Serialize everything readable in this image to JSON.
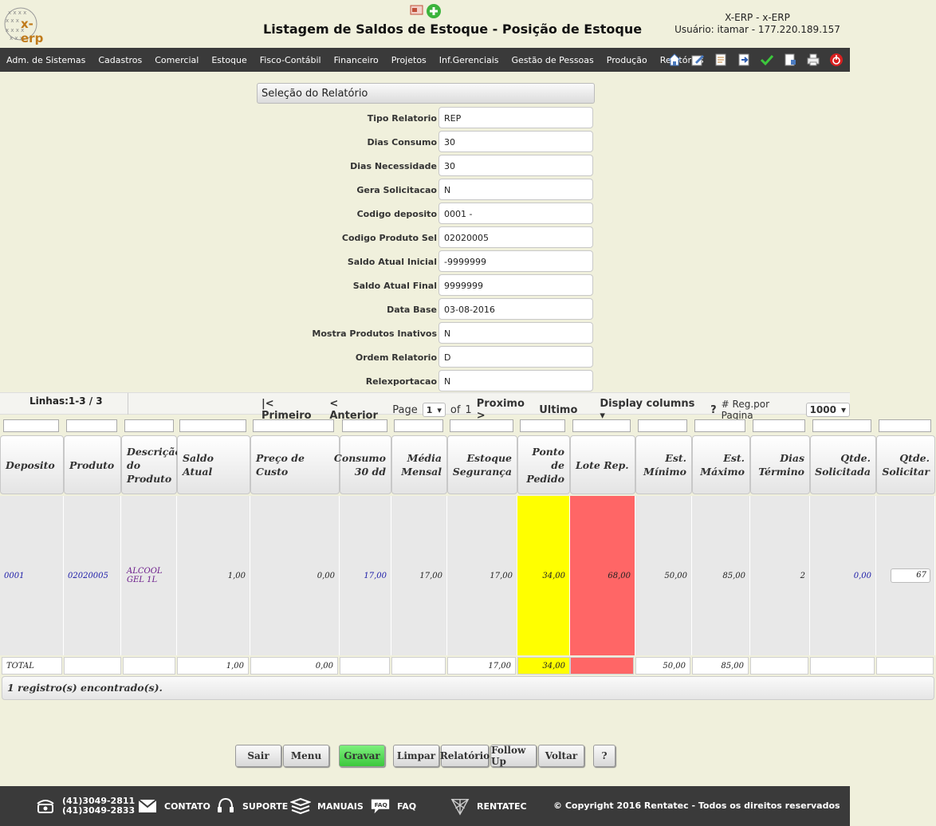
{
  "header": {
    "logo_text": "x-erp",
    "title": "Listagem de Saldos de Estoque - Posição de Estoque",
    "system": "X-ERP - x-ERP",
    "user": "Usuário: itamar - 177.220.189.157"
  },
  "menu": [
    "Adm. de Sistemas",
    "Cadastros",
    "Comercial",
    "Estoque",
    "Fisco-Contábil",
    "Financeiro",
    "Projetos",
    "Inf.Gerenciais",
    "Gestão de Pessoas",
    "Produção",
    "Relatórios"
  ],
  "menu_icons": [
    "home-icon",
    "edit-icon",
    "document-icon",
    "export-icon",
    "check-icon",
    "copy-icon",
    "print-icon",
    "power-icon"
  ],
  "selection": {
    "title": "Seleção do Relatório",
    "fields": [
      {
        "label": "Tipo Relatorio",
        "value": "REP"
      },
      {
        "label": "Dias Consumo",
        "value": "30"
      },
      {
        "label": "Dias Necessidade",
        "value": "30"
      },
      {
        "label": "Gera Solicitacao",
        "value": "N"
      },
      {
        "label": "Codigo deposito",
        "value": "0001 -"
      },
      {
        "label": "Codigo Produto Sel",
        "value": "02020005"
      },
      {
        "label": "Saldo Atual Inicial",
        "value": "-9999999"
      },
      {
        "label": "Saldo Atual Final",
        "value": "9999999"
      },
      {
        "label": "Data Base",
        "value": "03-08-2016"
      },
      {
        "label": "Mostra Produtos Inativos",
        "value": "N"
      },
      {
        "label": "Ordem Relatorio",
        "value": "D"
      },
      {
        "label": "Relexportacao",
        "value": "N"
      }
    ]
  },
  "pager": {
    "lines": "Linhas:1-3 / 3",
    "first": "|< Primeiro",
    "prev": "< Anterior",
    "page_label": "Page",
    "page_value": "1",
    "of_label": "of",
    "total_pages": "1",
    "next": "Proximo >",
    "last": "Ultimo",
    "display_columns": "Display columns ▾",
    "help": "?",
    "reg_label": "# Reg.por Pagina",
    "reg_value": "1000"
  },
  "table": {
    "headers": [
      "Deposito",
      "Produto",
      "Descrição do Produto",
      "Saldo Atual",
      "Preço de Custo",
      "Consumo 30 dd",
      "Média Mensal",
      "Estoque Segurança",
      "Ponto de Pedido",
      "Lote Rep.",
      "Est. Mínimo",
      "Est. Máximo",
      "Dias Término",
      "Qtde. Solicitada",
      "Qtde. Solicitar"
    ],
    "row": [
      "0001",
      "02020005",
      "ALCOOL GEL 1L",
      "1,00",
      "0,00",
      "17,00",
      "17,00",
      "17,00",
      "34,00",
      "68,00",
      "50,00",
      "85,00",
      "2",
      "0,00",
      "67"
    ],
    "total": [
      "TOTAL",
      "",
      "",
      "1,00",
      "0,00",
      "",
      "",
      "17,00",
      "34,00",
      "",
      "50,00",
      "85,00",
      "",
      "",
      ""
    ],
    "colors": {
      "ponto_pedido": "#ffff00",
      "lote_rep": "#ff6666"
    }
  },
  "found": "1 registro(s) encontrado(s).",
  "buttons": [
    "Sair",
    "Menu",
    "Gravar",
    "Limpar",
    "Relatório",
    "Follow Up",
    "Voltar",
    "?"
  ],
  "footer": {
    "phone1": "(41)3049-2811",
    "phone2": "(41)3049-2833",
    "contato": "CONTATO",
    "suporte": "SUPORTE",
    "manuais": "MANUAIS",
    "faq": "FAQ",
    "rentatec": "RENTATEC",
    "copyright": "© Copyright 2016 Rentatec - Todos os direitos reservados"
  }
}
